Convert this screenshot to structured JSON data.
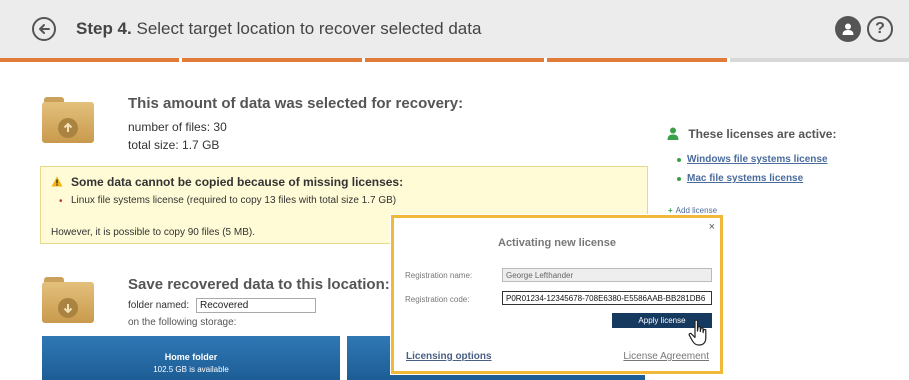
{
  "header": {
    "step": "Step 4.",
    "title": "Select target location to recover selected data",
    "progress_segments": 5,
    "progress_completed": 4
  },
  "summary": {
    "heading": "This amount of data was selected for recovery:",
    "files_label": "number of files:",
    "files_value": "30",
    "size_label": "total size:",
    "size_value": "1.7 GB"
  },
  "warning": {
    "title": "Some data cannot be copied because of missing licenses:",
    "items": [
      "Linux file systems license (required to copy 13 files with total size 1.7 GB)"
    ],
    "footer": "However, it is possible to copy 90 files (5 MB)."
  },
  "licenses": {
    "heading": "These licenses are active:",
    "items": [
      "Windows file systems license",
      "Mac file systems license"
    ],
    "add_label": "Add license"
  },
  "save": {
    "heading": "Save recovered data to this location:",
    "folder_label": "folder named:",
    "folder_value": "Recovered",
    "storage_label": "on the following storage:",
    "tiles": [
      {
        "name": "Home folder",
        "size": "102.5 GB is available"
      },
      {
        "name": "",
        "size": ""
      }
    ]
  },
  "dialog": {
    "title": "Activating new license",
    "reg_name_label": "Registration name:",
    "reg_name_value": "George Lefthander",
    "reg_code_label": "Registration code:",
    "reg_code_value": "P0R01234-12345678-708E6380-E5586AAB-BB281DB6",
    "apply_label": "Apply license",
    "options_link": "Licensing options",
    "agreement_link": "License Agreement",
    "close_symbol": "×"
  },
  "colors": {
    "accent_orange": "#e07b39",
    "dialog_border": "#f0b93a",
    "tile_blue": "#2f78b5",
    "apply_button": "#16395f"
  },
  "icons": [
    "back-arrow-icon",
    "user-icon",
    "help-icon",
    "folder-up-icon",
    "warning-icon",
    "user-license-icon",
    "folder-down-icon",
    "close-icon",
    "hand-cursor-icon"
  ]
}
